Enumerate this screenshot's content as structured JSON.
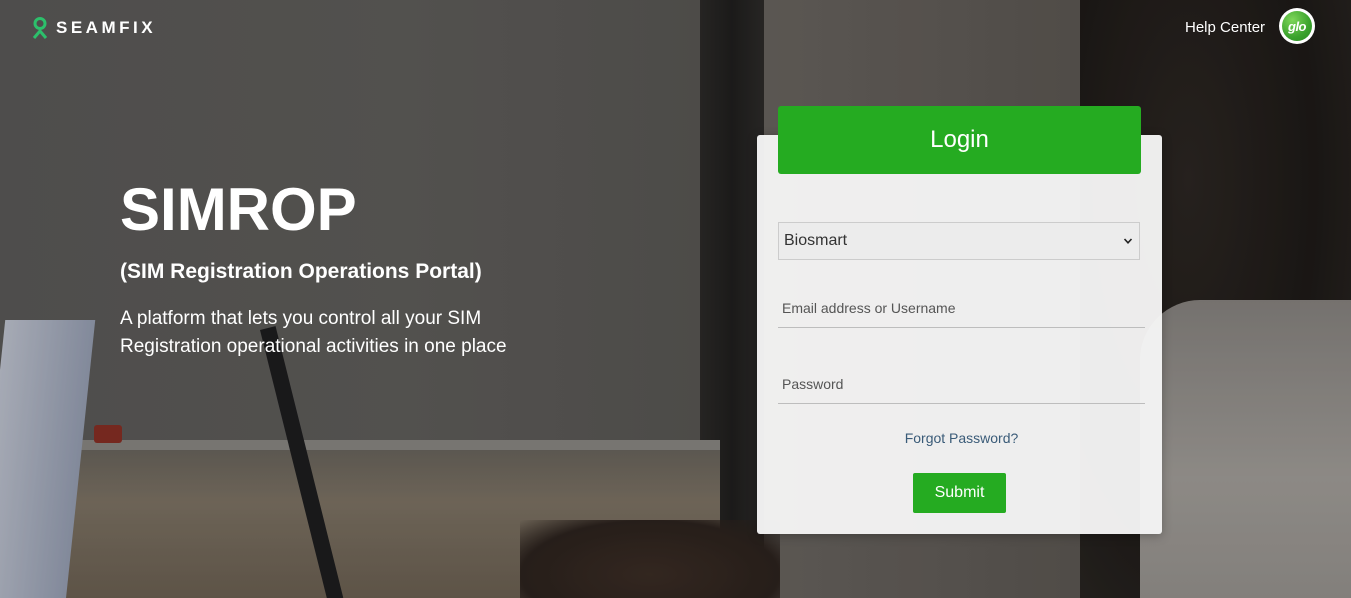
{
  "brand": {
    "logo_text": "SEAMFIX",
    "logo_icon": "seamfix-logo-icon",
    "accent_color": "#25ab21"
  },
  "header": {
    "help_center_label": "Help Center",
    "partner_logo_text": "glo"
  },
  "hero": {
    "title": "SIMROP",
    "subtitle": "(SIM Registration Operations Portal)",
    "description": "A platform that lets you control all your SIM Registration operational activities in one place"
  },
  "login": {
    "header_label": "Login",
    "organization_select": {
      "selected": "Biosmart",
      "icon": "chevron-down-icon"
    },
    "email_placeholder": "Email address or Username",
    "password_placeholder": "Password",
    "forgot_password_label": "Forgot Password?",
    "submit_label": "Submit"
  }
}
